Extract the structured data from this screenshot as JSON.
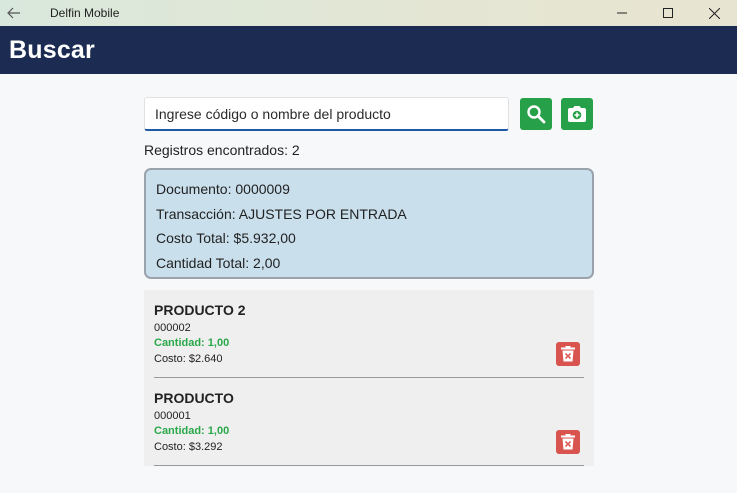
{
  "window": {
    "title": "Delfin Mobile"
  },
  "header": {
    "title": "Buscar"
  },
  "search": {
    "placeholder": "Ingrese código o nombre del producto",
    "value": ""
  },
  "records": {
    "text": "Registros encontrados: 2"
  },
  "summary": {
    "documento": "Documento: 0000009",
    "transaccion": "Transacción: AJUSTES POR ENTRADA",
    "costo_total": "Costo Total: $5.932,00",
    "cantidad_total": "Cantidad Total: 2,00"
  },
  "items": [
    {
      "name": "PRODUCTO 2",
      "code": "000002",
      "qty": "Cantidad: 1,00",
      "cost": "Costo: $2.640"
    },
    {
      "name": "PRODUCTO",
      "code": "000001",
      "qty": "Cantidad: 1,00",
      "cost": "Costo: $3.292"
    }
  ],
  "colors": {
    "appbar": "#1b2b52",
    "accent": "#27a149",
    "danger": "#d9534f",
    "summary_bg": "#c9dfec"
  },
  "icons": {
    "back": "back-arrow-icon",
    "search": "search-icon",
    "camera": "camera-add-icon",
    "delete": "trash-icon"
  }
}
